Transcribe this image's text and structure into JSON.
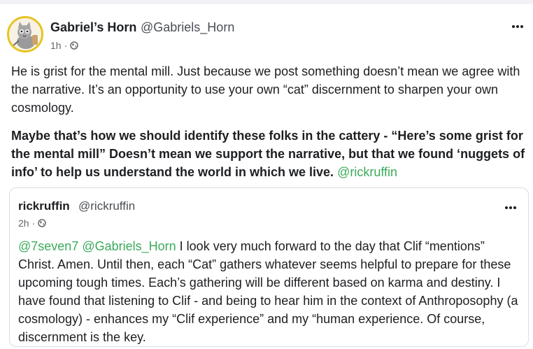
{
  "post": {
    "author_name": "Gabriel’s Horn",
    "author_handle": "@Gabriels_Horn",
    "time": "1h",
    "separator": "·",
    "avatar_icon": "cat-avatar",
    "paragraph1": "He is grist for the mental mill. Just because we post something doesn’t mean we agree with the narrative. It’s an opportunity to use your own “cat” discernment to sharpen your own cosmology.",
    "paragraph2": "Maybe that’s how we should identify these folks in the cattery - “Here’s some grist for the mental mill” Doesn’t mean we support the narrative, but that we found ‘nuggets of info’ to help us understand the world in which we live.",
    "paragraph2_mention": "@rickruffin"
  },
  "quoted": {
    "author_name": "rickruffin",
    "author_handle": "@rickruffin",
    "time": "2h",
    "separator": "·",
    "mention1": "@7seven7",
    "mention2": "@Gabriels_Horn",
    "text": " I look very much forward to the day that Clif “mentions” Christ. Amen. Until then, each “Cat” gathers whatever seems helpful to prepare for these upcoming tough times. Each’s gathering will be different based on karma and destiny. I have found that listening to Clif - and being to hear him in the context of Anthroposophy (a cosmology) - enhances my “Clif experience” and my “human experience. Of course, discernment is the key."
  },
  "colors": {
    "mention": "#3bab5a",
    "avatar_ring": "#e8c31f",
    "background": "#f0f2f5"
  }
}
